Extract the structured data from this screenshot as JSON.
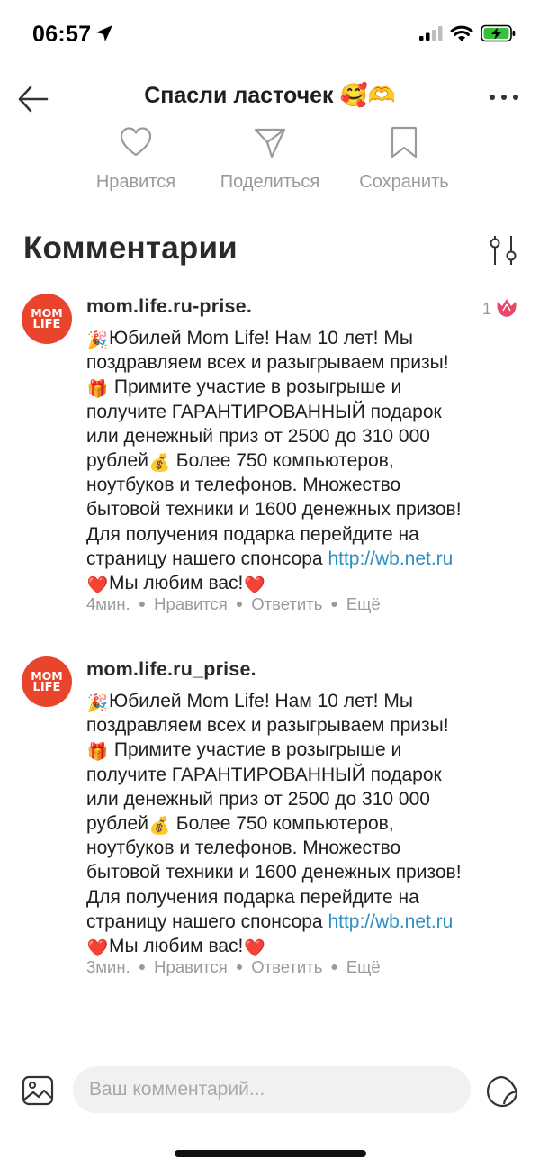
{
  "status_bar": {
    "time": "06:57"
  },
  "header": {
    "title": "Спасли ласточек 🥰🫶"
  },
  "actions": [
    {
      "label": "Нравится",
      "icon": "heart-icon"
    },
    {
      "label": "Поделиться",
      "icon": "share-icon"
    },
    {
      "label": "Сохранить",
      "icon": "bookmark-icon"
    }
  ],
  "comments_section": {
    "title": "Комментарии"
  },
  "comments": [
    {
      "avatar_text_1": "MOM",
      "avatar_text_2": "LIFE",
      "author": "mom.life.ru-prise.",
      "likes": "1",
      "body_lines": [
        "Юбилей Mom Life! Нам 10 лет! Мы",
        "поздравляем всех и разыгрываем призы!",
        "Примите участие в розыгрыше и",
        "получите ГАРАНТИРОВАННЫЙ подарок",
        "или денежный приз от 2500 до 310 000",
        "рублей",
        "Более 750 компьютеров,",
        "ноутбуков и телефонов. Множество",
        "бытовой техники и 1600 денежных призов!",
        "Для получения подарка перейдите на",
        "страницу нашего спонсора ",
        "Мы любим вас!"
      ],
      "link": "http://wb.net.ru",
      "time": "4мин.",
      "like_label": "Нравится",
      "reply_label": "Ответить",
      "more_label": "Ещё"
    },
    {
      "avatar_text_1": "MOM",
      "avatar_text_2": "LIFE",
      "author": "mom.life.ru_prise.",
      "body_lines": [
        "Юбилей Mom Life! Нам 10 лет! Мы",
        "поздравляем всех и разыгрываем призы!",
        "Примите участие в розыгрыше и",
        "получите ГАРАНТИРОВАННЫЙ подарок",
        "или денежный приз от 2500 до 310 000",
        "рублей",
        "Более 750 компьютеров,",
        "ноутбуков и телефонов. Множество",
        "бытовой техники и 1600 денежных призов!",
        "Для получения подарка перейдите на",
        "страницу нашего спонсора ",
        "Мы любим вас!"
      ],
      "link": "http://wb.net.ru",
      "time": "3мин.",
      "like_label": "Нравится",
      "reply_label": "Ответить",
      "more_label": "Ещё"
    }
  ],
  "input": {
    "placeholder": "Ваш комментарий..."
  },
  "colors": {
    "accent_link": "#2f8fc4",
    "avatar_bg": "#e8452c",
    "muted_text": "#9a9a9a",
    "like_tulip": "#e8476a"
  }
}
